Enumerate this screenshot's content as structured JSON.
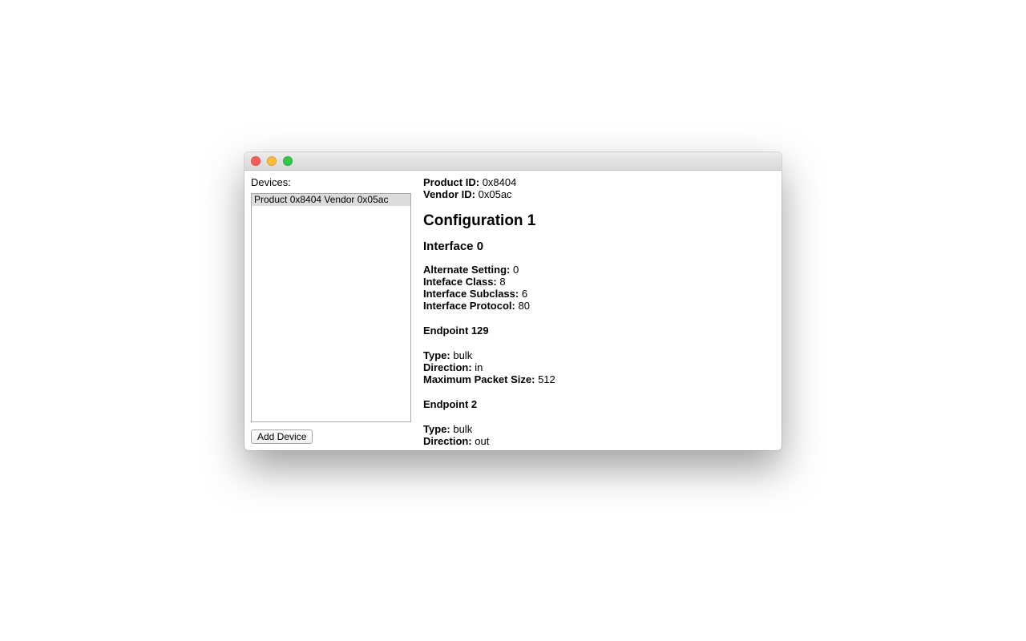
{
  "window": {
    "controls": [
      "close",
      "minimize",
      "zoom"
    ]
  },
  "devices": {
    "label": "Devices:",
    "items": [
      {
        "label": "Product 0x8404 Vendor 0x05ac",
        "selected": true
      }
    ],
    "add_button_label": "Add Device"
  },
  "details": {
    "product_id": {
      "label": "Product ID:",
      "value": "0x8404"
    },
    "vendor_id": {
      "label": "Vendor ID:",
      "value": "0x05ac"
    },
    "configuration_title": "Configuration 1",
    "interface_title": "Interface 0",
    "interface": {
      "alternate_setting": {
        "label": "Alternate Setting:",
        "value": "0"
      },
      "class": {
        "label": "Inteface Class:",
        "value": "8"
      },
      "subclass": {
        "label": "Interface Subclass:",
        "value": "6"
      },
      "protocol": {
        "label": "Interface Protocol:",
        "value": "80"
      }
    },
    "endpoints": [
      {
        "title": "Endpoint 129",
        "type": {
          "label": "Type:",
          "value": "bulk"
        },
        "direction": {
          "label": "Direction:",
          "value": "in"
        },
        "max_packet_size": {
          "label": "Maximum Packet Size:",
          "value": "512"
        }
      },
      {
        "title": "Endpoint 2",
        "type": {
          "label": "Type:",
          "value": "bulk"
        },
        "direction": {
          "label": "Direction:",
          "value": "out"
        }
      }
    ]
  }
}
